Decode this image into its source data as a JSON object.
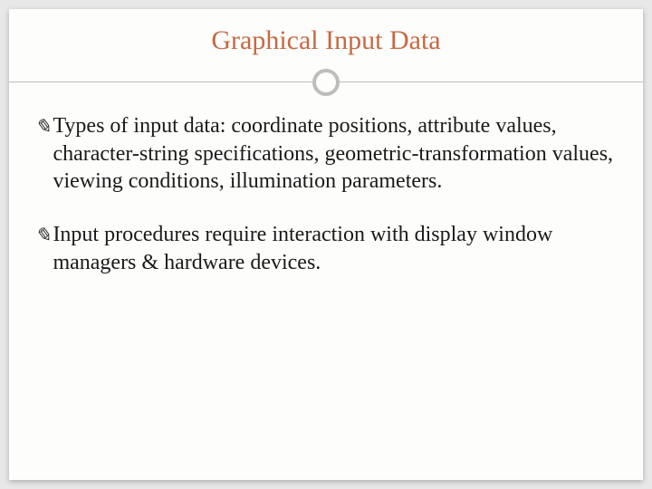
{
  "slide": {
    "title": "Graphical Input Data",
    "bullets": [
      {
        "glyph": "✎",
        "text": "Types of input data: coordinate positions, attribute values, character-string specifications, geometric-transformation values, viewing conditions, illumination parameters."
      },
      {
        "glyph": "✎",
        "text": "Input procedures require interaction with display window managers & hardware devices."
      }
    ]
  }
}
